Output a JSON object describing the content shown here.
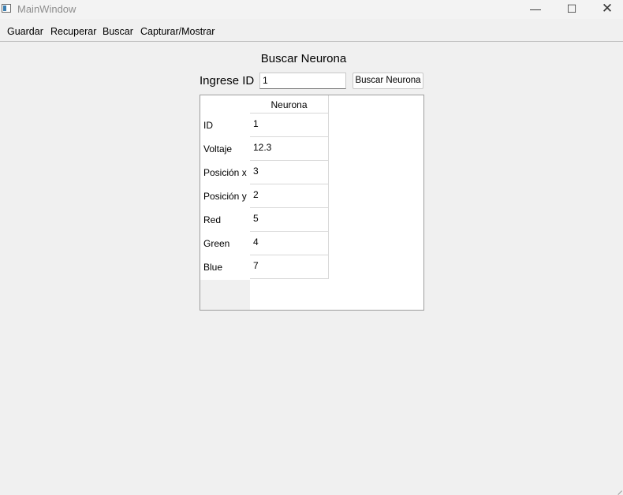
{
  "window": {
    "title": "MainWindow",
    "minimize_glyph": "—",
    "maximize_glyph": "☐",
    "close_glyph": "✕"
  },
  "menu": [
    "Guardar",
    "Recuperar",
    "Buscar",
    "Capturar/Mostrar"
  ],
  "search": {
    "heading": "Buscar Neurona",
    "label": "Ingrese ID",
    "value": "1",
    "button": "Buscar Neurona"
  },
  "table": {
    "column_header": "Neurona",
    "rows": [
      {
        "label": "ID",
        "value": "1"
      },
      {
        "label": "Voltaje",
        "value": "12.3"
      },
      {
        "label": "Posición x",
        "value": "3"
      },
      {
        "label": "Posición y",
        "value": "2"
      },
      {
        "label": "Red",
        "value": "5"
      },
      {
        "label": "Green",
        "value": "4"
      },
      {
        "label": "Blue",
        "value": "7"
      }
    ]
  }
}
